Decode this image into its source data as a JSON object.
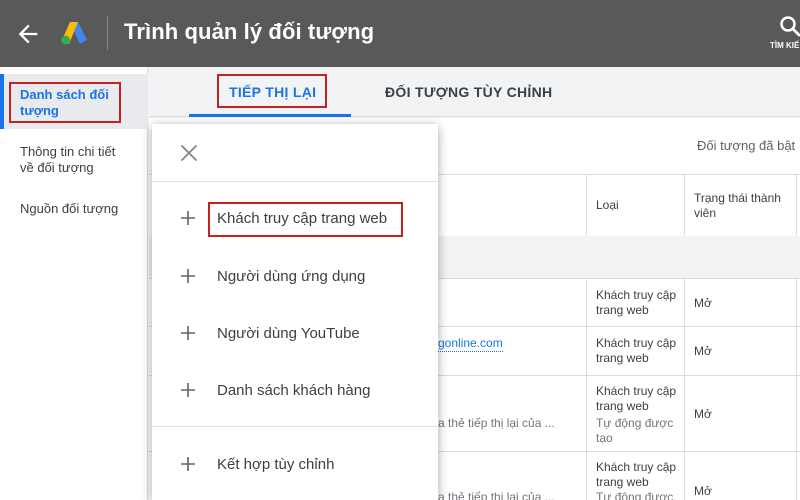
{
  "header": {
    "title": "Trình quản lý đối tượng",
    "search_label": "TÌM KIẾ"
  },
  "sidebar": {
    "items": [
      {
        "label": "Danh sách đối tượng",
        "active": true
      },
      {
        "label": "Thông tin chi tiết về đối tượng",
        "active": false
      },
      {
        "label": "Nguồn đối tượng",
        "active": false
      }
    ]
  },
  "tabs": [
    {
      "label": "TIẾP THỊ LẠI",
      "active": true
    },
    {
      "label": "ĐỐI TƯỢNG TÙY CHỈNH",
      "active": false
    }
  ],
  "filter_text": "Đối tượng đã bật",
  "table": {
    "headers": {
      "type": "Loại",
      "status": "Trạng thái thành viên"
    },
    "rows": [
      {
        "name": "",
        "description": "",
        "type": "Khách truy cập trang web",
        "type_sub": "",
        "status": "Mở"
      },
      {
        "name": "gonline.com",
        "description": "",
        "type": "Khách truy cập trang web",
        "type_sub": "",
        "status": "Mở"
      },
      {
        "name": "",
        "description": "a thẻ tiếp thị lại của ...",
        "type": "Khách truy cập trang web",
        "type_sub": "Tự động được tạo",
        "status": "Mở"
      },
      {
        "name": "",
        "description": "a thẻ tiếp thị lại của ...",
        "type": "Khách truy cập trang web",
        "type_sub": "Tự động được",
        "status": "Mở"
      }
    ]
  },
  "panel": {
    "items": [
      {
        "label": "Khách truy cập trang web",
        "highlighted": true
      },
      {
        "label": "Người dùng ứng dụng"
      },
      {
        "label": "Người dùng YouTube"
      },
      {
        "label": "Danh sách khách hàng"
      },
      {
        "label": "Kết hợp tùy chỉnh"
      }
    ]
  },
  "icons": {
    "back": "arrow-left-icon",
    "logo": "google-ads-logo",
    "search": "search-icon",
    "close": "close-icon",
    "add": "plus-icon"
  },
  "colors": {
    "accent": "#1a73e8",
    "highlight_box": "#c5221f",
    "header_bg": "#595959"
  }
}
